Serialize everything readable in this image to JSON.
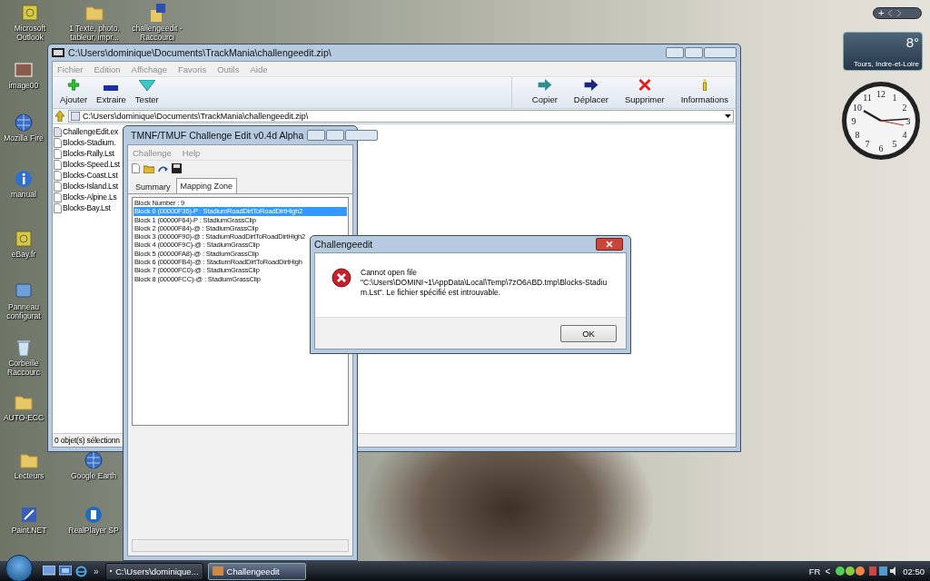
{
  "desktop_icons": [
    {
      "label": "Microsoft Outlook"
    },
    {
      "label": "1 Texte, photo, tableur, impr..."
    },
    {
      "label": "challengeedit - Raccourci"
    },
    {
      "label": "image00"
    },
    {
      "label": "Mozilla Fire"
    },
    {
      "label": "manual"
    },
    {
      "label": "eBay.fr"
    },
    {
      "label": "Panneau configurat"
    },
    {
      "label": "Corbeille Raccourc"
    },
    {
      "label": "AUTO-ECC"
    },
    {
      "label": "Lecteurs"
    },
    {
      "label": "Google Earth"
    },
    {
      "label": "Paint.NET"
    },
    {
      "label": "RealPlayer SP"
    }
  ],
  "gadgets": {
    "add_button": "+",
    "weather": {
      "temperature": "8°",
      "location": "Tours, Indre-et-Loire"
    },
    "clock": {
      "numerals": [
        "12",
        "1",
        "2",
        "3",
        "4",
        "5",
        "6",
        "7",
        "8",
        "9",
        "10",
        "11"
      ]
    }
  },
  "archive_window": {
    "title": "C:\\Users\\dominique\\Documents\\TrackMania\\challengeedit.zip\\",
    "menu": [
      "Fichier",
      "Edition",
      "Affichage",
      "Favoris",
      "Outils",
      "Aide"
    ],
    "toolbar_left": [
      {
        "label": "Ajouter"
      },
      {
        "label": "Extraire"
      },
      {
        "label": "Tester"
      }
    ],
    "toolbar_right": [
      {
        "label": "Copier"
      },
      {
        "label": "Déplacer"
      },
      {
        "label": "Supprimer"
      },
      {
        "label": "Informations"
      }
    ],
    "address": "C:\\Users\\dominique\\Documents\\TrackMania\\challengeedit.zip\\",
    "files": [
      {
        "name": "ChallengeEdit.ex"
      },
      {
        "name": "Blocks-Stadium."
      },
      {
        "name": "Blocks-Rally.Lst"
      },
      {
        "name": "Blocks-Speed.Lst"
      },
      {
        "name": "Blocks-Coast.Lst"
      },
      {
        "name": "Blocks-Island.Lst"
      },
      {
        "name": "Blocks-Alpine.Ls"
      },
      {
        "name": "Blocks-Bay.Lst"
      }
    ],
    "status": "0 objet(s) sélectionn"
  },
  "editor_window": {
    "title": "TMNF/TMUF Challenge Edit v0.4d Alpha",
    "menu": [
      "Challenge",
      "Help"
    ],
    "tabs": [
      {
        "label": "Summary",
        "selected": false
      },
      {
        "label": "Mapping Zone",
        "selected": true
      }
    ],
    "list": [
      {
        "text": "Block Number : 9",
        "selected": false
      },
      {
        "text": "Block 0 (00000F36)-P : StadiumRoadDirtToRoadDirtHigh2",
        "selected": true
      },
      {
        "text": "Block 1 (00000F64)-P : StadiumGrassClip",
        "selected": false
      },
      {
        "text": "Block 2 (00000F84)-@ : StadiumGrassClip",
        "selected": false
      },
      {
        "text": "Block 3 (00000F90)-@ : StadiumRoadDirtToRoadDirtHigh2",
        "selected": false
      },
      {
        "text": "Block 4 (00000F9C)-@ : StadiumGrassClip",
        "selected": false
      },
      {
        "text": "Block 5 (00000FA8)-@ : StadiumGrassClip",
        "selected": false
      },
      {
        "text": "Block 6 (00000FB4)-@ : StadiumRoadDirtToRoadDirtHigh",
        "selected": false
      },
      {
        "text": "Block 7 (00000FC0)-@ : StadiumGrassClip",
        "selected": false
      },
      {
        "text": "Block 8 (00000FCC)-@ : StadiumGrassClip",
        "selected": false
      }
    ]
  },
  "dialog": {
    "title": "Challengeedit",
    "heading": "Cannot open file",
    "message": "\"C:\\Users\\DOMINI~1\\AppData\\Local\\Temp\\7zO6ABD.tmp\\Blocks-Stadium.Lst\". Le fichier spécifié est introuvable.",
    "button": "OK"
  },
  "taskbar": {
    "overflow": "»",
    "tasks": [
      {
        "label": "C:\\Users\\dominique...",
        "selected": false
      },
      {
        "label": "Challengeedit",
        "selected": true
      }
    ],
    "language": "FR",
    "tray_toggle": "<",
    "time": "02:50"
  }
}
